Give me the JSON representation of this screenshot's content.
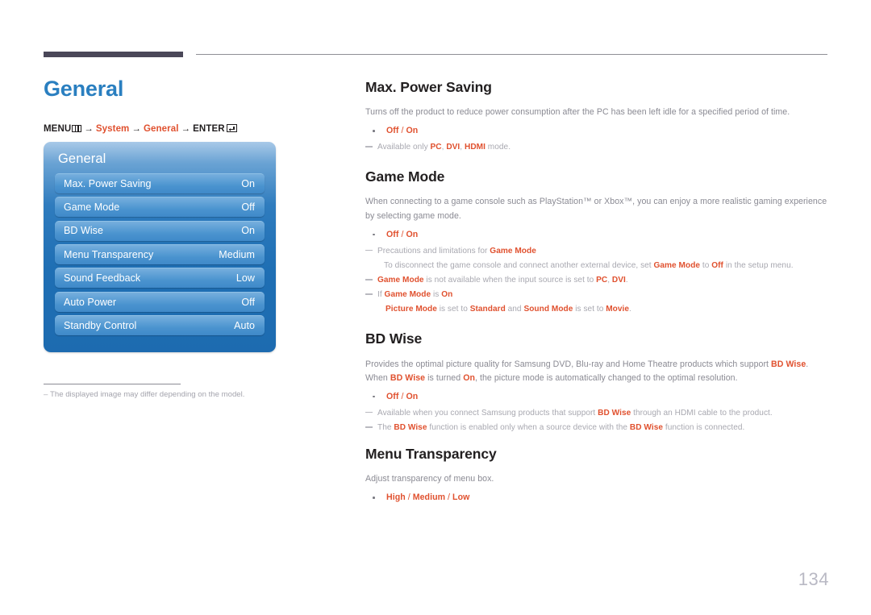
{
  "document": {
    "page_number": "134",
    "chapter_title": "General"
  },
  "breadcrumb": {
    "menu_label": "MENU",
    "menu_icon": "menu-grid-icon",
    "arrow": "→",
    "step1": "System",
    "step2": "General",
    "enter_label": "ENTER",
    "enter_icon": "enter-key-icon"
  },
  "osd": {
    "title": "General",
    "rows": [
      {
        "label": "Max. Power Saving",
        "value": "On"
      },
      {
        "label": "Game Mode",
        "value": "Off"
      },
      {
        "label": "BD Wise",
        "value": "On"
      },
      {
        "label": "Menu Transparency",
        "value": "Medium"
      },
      {
        "label": "Sound Feedback",
        "value": "Low"
      },
      {
        "label": "Auto Power",
        "value": "Off"
      },
      {
        "label": "Standby Control",
        "value": "Auto"
      }
    ]
  },
  "left_footnote": {
    "dash": "–",
    "text": "The displayed image may differ depending on the model."
  },
  "sections": {
    "max_power_saving": {
      "title": "Max. Power Saving",
      "body": "Turns off the product to reduce power consumption after the PC has been left idle for a specified period of time.",
      "options": {
        "a": "Off",
        "sep": " / ",
        "b": "On"
      },
      "note1": {
        "pre": "Available only ",
        "k1": "PC",
        "c1": ", ",
        "k2": "DVI",
        "c2": ", ",
        "k3": "HDMI",
        "post": " mode."
      }
    },
    "game_mode": {
      "title": "Game Mode",
      "body": "When connecting to a game console such as PlayStation™ or Xbox™, you can enjoy a more realistic gaming experience by selecting game mode.",
      "options": {
        "a": "Off",
        "sep": " / ",
        "b": "On"
      },
      "note1": {
        "pre": "Precautions and limitations for ",
        "k1": "Game Mode"
      },
      "note1_sub": {
        "pre": "To disconnect the game console and connect another external device, set ",
        "k1": "Game Mode",
        "mid": " to ",
        "k2": "Off",
        "post": " in the setup menu."
      },
      "note2": {
        "k1": "Game Mode",
        "mid": " is not available when the input source is set to ",
        "k2": "PC",
        "c": ", ",
        "k3": "DVI",
        "post": "."
      },
      "note3": {
        "pre": "If ",
        "k1": "Game Mode",
        "mid": " is ",
        "k2": "On"
      },
      "note3_sub": {
        "k1": "Picture Mode",
        "mid": " is set to ",
        "k2": "Standard",
        "mid2": " and ",
        "k3": "Sound Mode",
        "mid3": " is set to ",
        "k4": "Movie",
        "post": "."
      }
    },
    "bd_wise": {
      "title": "BD Wise",
      "body_pre": "Provides the optimal picture quality for Samsung DVD, Blu-ray and Home Theatre products which support ",
      "body_k1": "BD Wise",
      "body_mid": ". When ",
      "body_k2": "BD Wise",
      "body_mid2": " is turned ",
      "body_k3": "On",
      "body_post": ", the picture mode is automatically changed to the optimal resolution.",
      "options": {
        "a": "Off",
        "sep": " / ",
        "b": "On"
      },
      "note1": {
        "pre": "Available when you connect Samsung products that support ",
        "k1": "BD Wise",
        "post": " through an HDMI cable to the product."
      },
      "note2": {
        "pre": "The ",
        "k1": "BD Wise",
        "mid": " function is enabled only when a source device with the ",
        "k2": "BD Wise",
        "post": " function is connected."
      }
    },
    "menu_transparency": {
      "title": "Menu Transparency",
      "body": "Adjust transparency of menu box.",
      "options": {
        "a": "High",
        "sep1": " / ",
        "b": "Medium",
        "sep2": " / ",
        "c": "Low"
      }
    }
  },
  "colors": {
    "accent_red": "#e0512f",
    "chapter_blue": "#2a7fc0",
    "osd_blue": "#1f6fb4",
    "body_gray": "#8a8a93"
  }
}
